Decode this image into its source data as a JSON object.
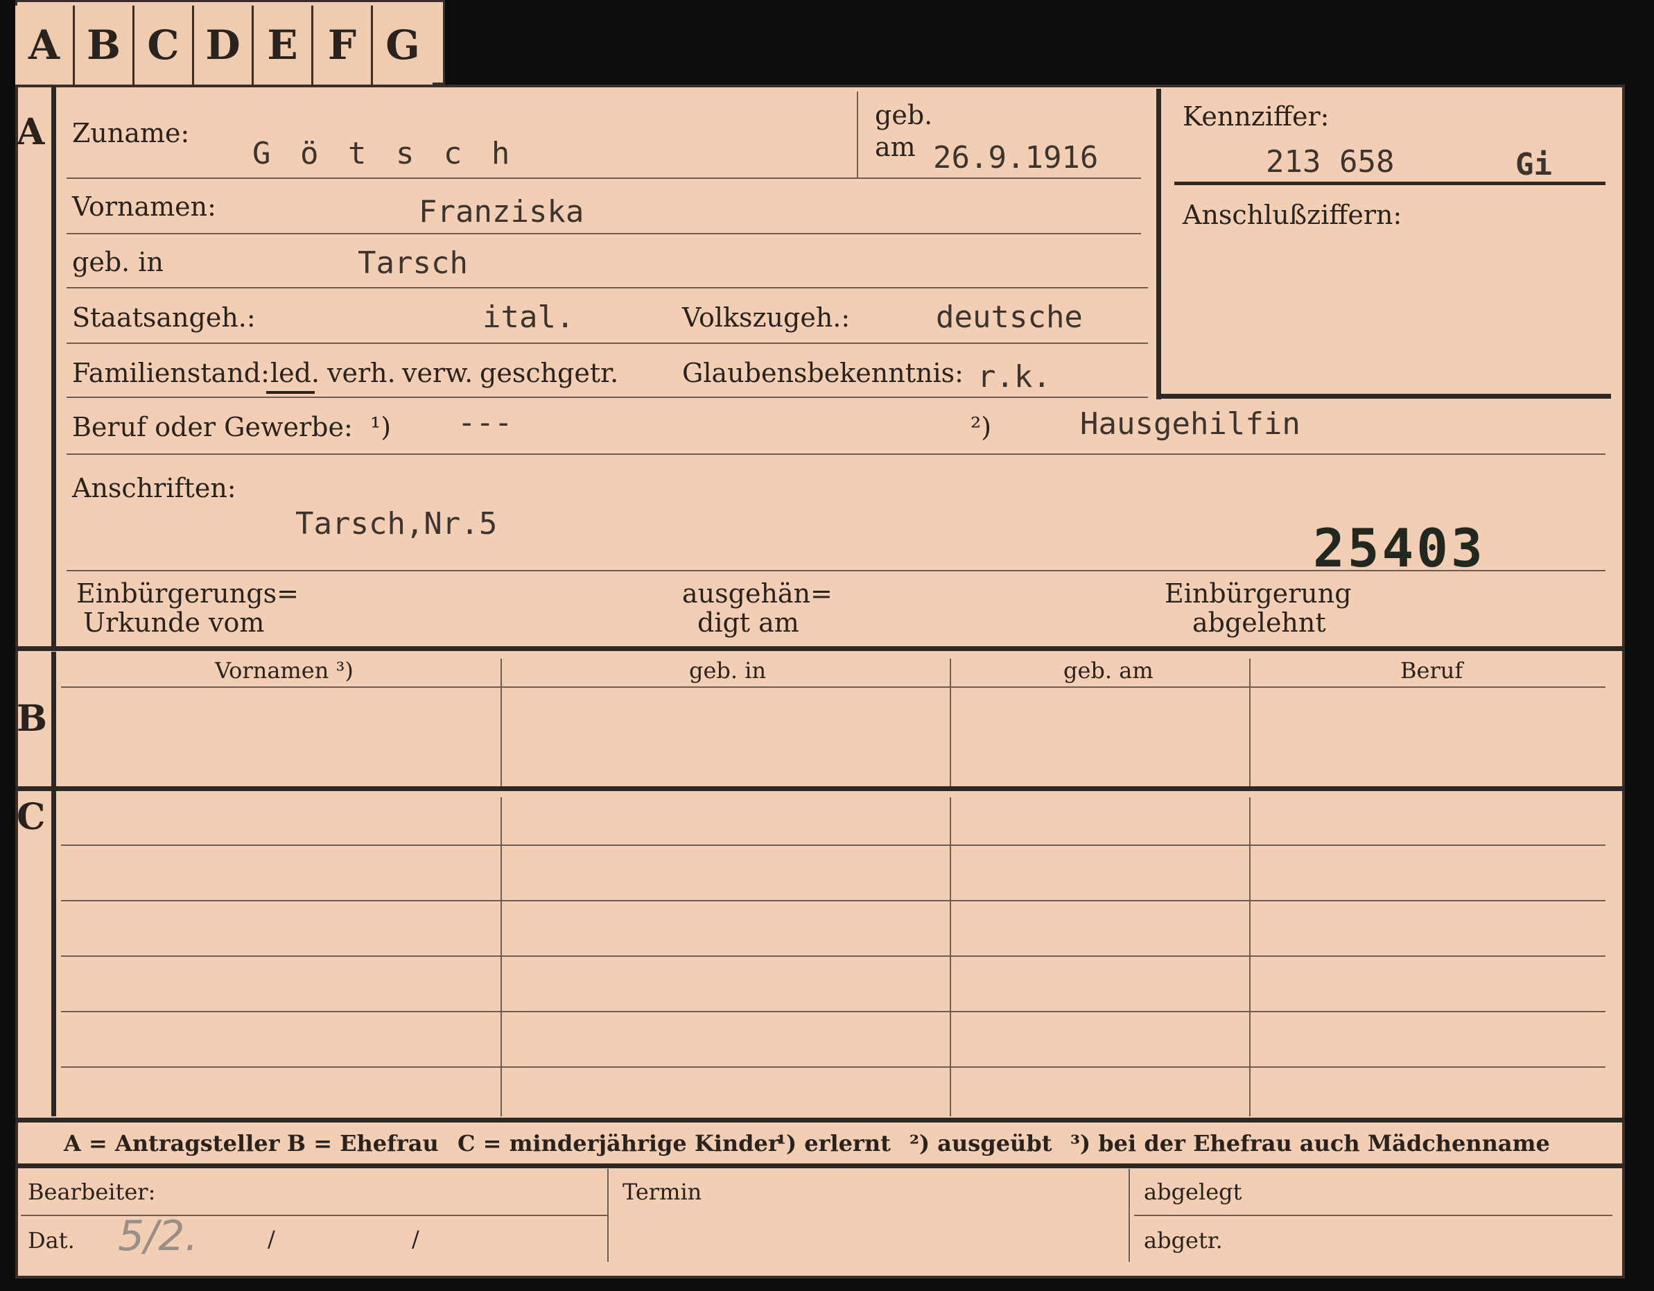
{
  "tabs": [
    "A",
    "B",
    "C",
    "D",
    "E",
    "F",
    "G"
  ],
  "section_a": {
    "marker": "A",
    "zuname_label": "Zuname:",
    "zuname_value": "G ö t s c h",
    "geb_label": "geb.",
    "am_label": "am",
    "geb_am_value": "26.9.1916",
    "vornamen_label": "Vornamen:",
    "vornamen_value": "Franziska",
    "geb_in_label": "geb. in",
    "geb_in_value": "Tarsch",
    "staatsangeh_label": "Staatsangeh.:",
    "staatsangeh_value": "ital.",
    "volkszugeh_label": "Volkszugeh.:",
    "volkszugeh_value": "deutsche",
    "familienstand_label": "Familienstand:",
    "familienstand_options": [
      "led.",
      "verh.",
      "verw.",
      "gesch.",
      "getr."
    ],
    "glaubens_label": "Glaubensbekenntnis:",
    "glaubens_value": "r.k.",
    "beruf_label": "Beruf oder Gewerbe:",
    "beruf_mark1": "¹)",
    "beruf_value1": "---",
    "beruf_mark2": "²)",
    "beruf_value2": "Hausgehilfin",
    "anschriften_label": "Anschriften:",
    "anschriften_value": "Tarsch,Nr.5",
    "stamp_number": "25403",
    "einb_urkunde_line1": "Einbürgerungs=",
    "einb_urkunde_line2": "Urkunde vom",
    "ausgehaendigt_line1": "ausgehän=",
    "ausgehaendigt_line2": "digt am",
    "einb_abgelehnt_line1": "Einbürgerung",
    "einb_abgelehnt_line2": "abgelehnt",
    "kennziffer_label": "Kennziffer:",
    "kennziffer_value": "213 658",
    "kennziffer_suffix": "Gi",
    "anschluss_label": "Anschlußziffern:"
  },
  "section_b": {
    "marker": "B",
    "columns": [
      "Vornamen ³)",
      "geb. in",
      "geb. am",
      "Beruf"
    ]
  },
  "section_c": {
    "marker": "C"
  },
  "legend": {
    "a": "A = Antragsteller",
    "b": "B = Ehefrau",
    "c": "C = minderjährige Kinder",
    "n1": "¹) erlernt",
    "n2": "²) ausgeübt",
    "n3": "³) bei der Ehefrau auch Mädchenname"
  },
  "footer": {
    "bearbeiter_label": "Bearbeiter:",
    "dat_label": "Dat.",
    "dat_value": "5/2.",
    "dat_slash1": "/",
    "dat_slash2": "/",
    "termin_label": "Termin",
    "abgelegt_label": "abgelegt",
    "abgetr_label": "abgetr."
  }
}
